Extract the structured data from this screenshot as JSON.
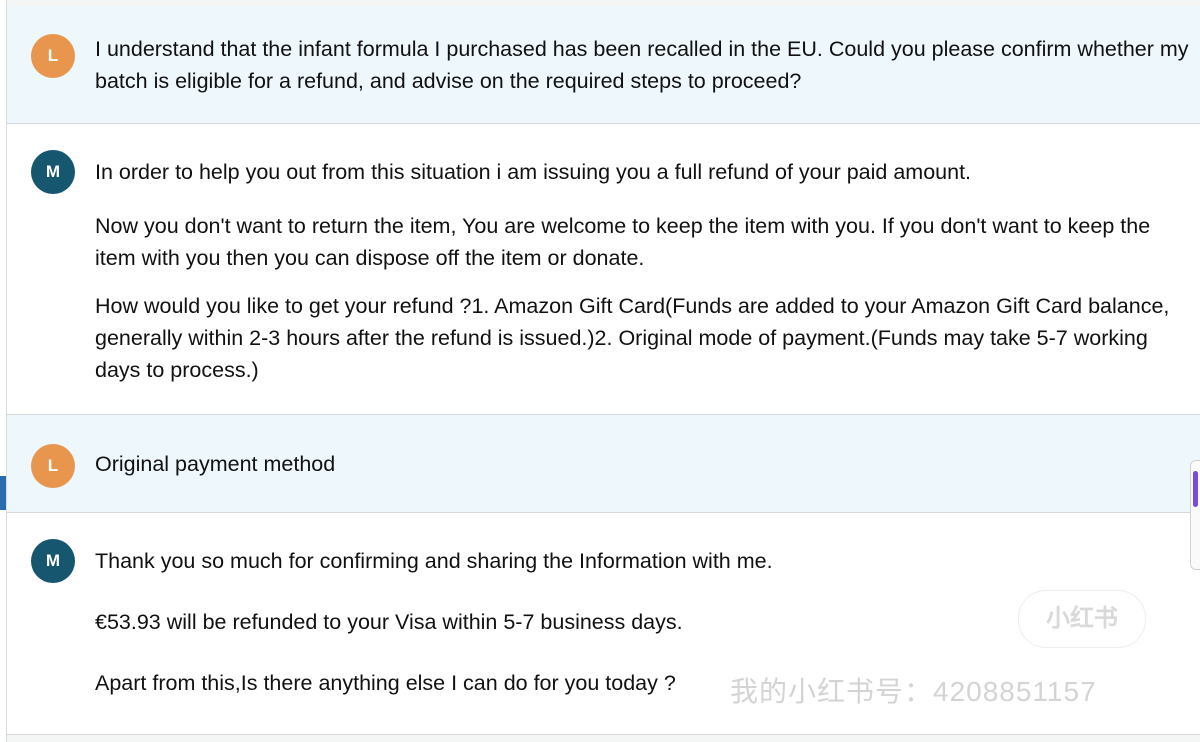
{
  "chat": {
    "messages": [
      {
        "sender_initial": "L",
        "paragraphs": [
          "I understand that the infant formula I purchased has been recalled in the EU. Could you please confirm whether my batch is eligible for a refund, and advise on the required steps to proceed?"
        ]
      },
      {
        "sender_initial": "M",
        "paragraphs": [
          "In order to help you out from this situation i am issuing you a full refund of your paid amount.",
          "Now you don't want to return the item, You are welcome to keep the item with you. If you don't want to keep the item with you then you can dispose off the item or donate.",
          "How would you like to get your refund ?1. Amazon Gift Card(Funds are added to your Amazon Gift Card balance, generally within 2-3 hours after the refund is issued.)2. Original mode of payment.(Funds may take 5-7 working days to process.)"
        ]
      },
      {
        "sender_initial": "L",
        "paragraphs": [
          "Original payment method"
        ]
      },
      {
        "sender_initial": "M",
        "paragraphs": [
          "Thank you so much for confirming and sharing the Information with me.",
          "€53.93 will be refunded to your Visa within 5-7 business days.",
          "Apart from this,Is there anything else I can do for you today ?"
        ]
      }
    ]
  },
  "watermark": {
    "logo_text": "小红书",
    "id_text": "我的小红书号：4208851157"
  },
  "colors": {
    "user_bubble_bg": "#eef7fb",
    "agent_bubble_bg": "#ffffff",
    "user_avatar": "#e8964e",
    "agent_avatar": "#17566f"
  }
}
